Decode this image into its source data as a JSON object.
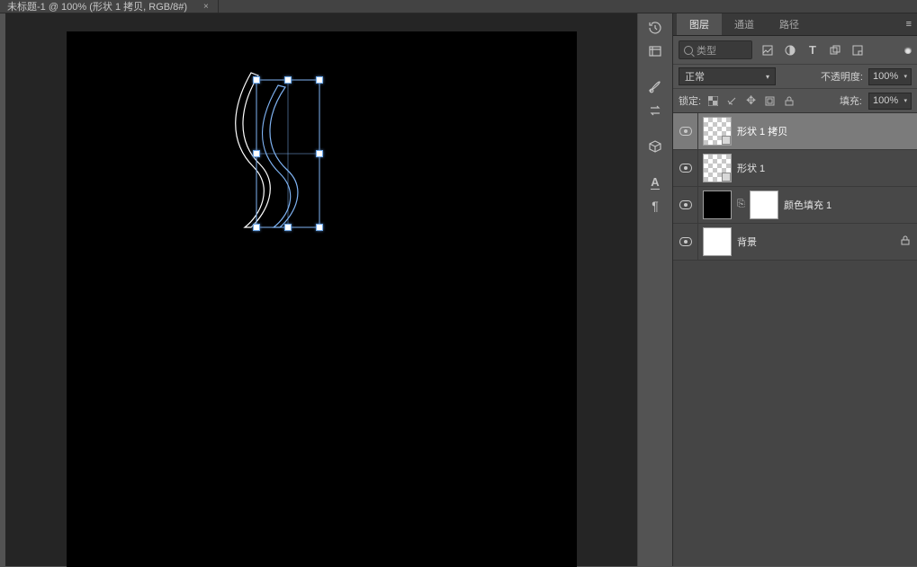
{
  "document_tab_title": "未标题-1 @ 100% (形状 1 拷贝, RGB/8#)",
  "panel_tabs": {
    "layers": "图层",
    "channels": "通道",
    "paths": "路径"
  },
  "filter": {
    "placeholder": "类型"
  },
  "blend": {
    "mode": "正常"
  },
  "opacity": {
    "label": "不透明度:",
    "value": "100%"
  },
  "locks": {
    "label": "锁定:"
  },
  "fill": {
    "label": "填充:",
    "value": "100%"
  },
  "layers": [
    {
      "name": "形状 1 拷贝"
    },
    {
      "name": "形状 1"
    },
    {
      "name": "颜色填充 1"
    },
    {
      "name": "背景"
    }
  ]
}
